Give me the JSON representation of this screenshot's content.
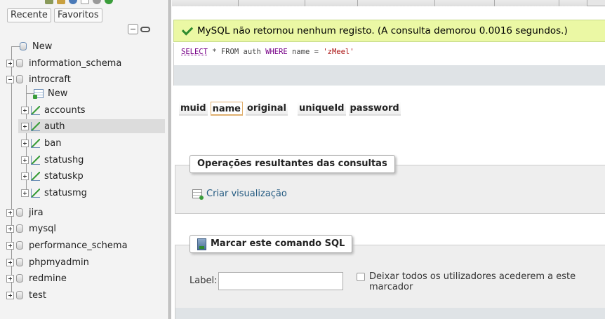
{
  "nav": {
    "tabs": [
      "Recente",
      "Favoritos"
    ],
    "tree": [
      {
        "label": "New",
        "kind": "new"
      },
      {
        "label": "information_schema",
        "kind": "db"
      },
      {
        "label": "introcraft",
        "kind": "db-open"
      },
      {
        "label": "New",
        "kind": "new-table"
      },
      {
        "label": "accounts",
        "kind": "table"
      },
      {
        "label": "auth",
        "kind": "table",
        "selected": true
      },
      {
        "label": "ban",
        "kind": "table"
      },
      {
        "label": "statushg",
        "kind": "table"
      },
      {
        "label": "statuskp",
        "kind": "table"
      },
      {
        "label": "statusmg",
        "kind": "table"
      },
      {
        "label": "jira",
        "kind": "db"
      },
      {
        "label": "mysql",
        "kind": "db"
      },
      {
        "label": "performance_schema",
        "kind": "db"
      },
      {
        "label": "phpmyadmin",
        "kind": "db"
      },
      {
        "label": "redmine",
        "kind": "db"
      },
      {
        "label": "test",
        "kind": "db"
      }
    ]
  },
  "main": {
    "success_message": "MySQL não retornou nenhum registo. (A consulta demorou 0.0016 segundos.)",
    "sql": {
      "select": "SELECT",
      "star_from": " * FROM auth ",
      "where": "WHERE",
      "cond": " name = ",
      "value": "'zMeel'"
    },
    "columns": [
      "muid",
      "name",
      "original",
      "uniqueId",
      "password"
    ],
    "sorted_column": "name",
    "query_ops": {
      "legend": "Operações resultantes das consultas",
      "create_view": "Criar visualização"
    },
    "bookmark": {
      "legend": "Marcar este comando SQL",
      "label_text": "Label:",
      "label_value": "",
      "share_label": "Deixar todos os utilizadores acederem a este marcador"
    }
  },
  "colors": {
    "success_bg": "#ebf8a4",
    "link": "#235a81",
    "sql_keyword": "#770088",
    "sql_string": "#aa1111"
  }
}
